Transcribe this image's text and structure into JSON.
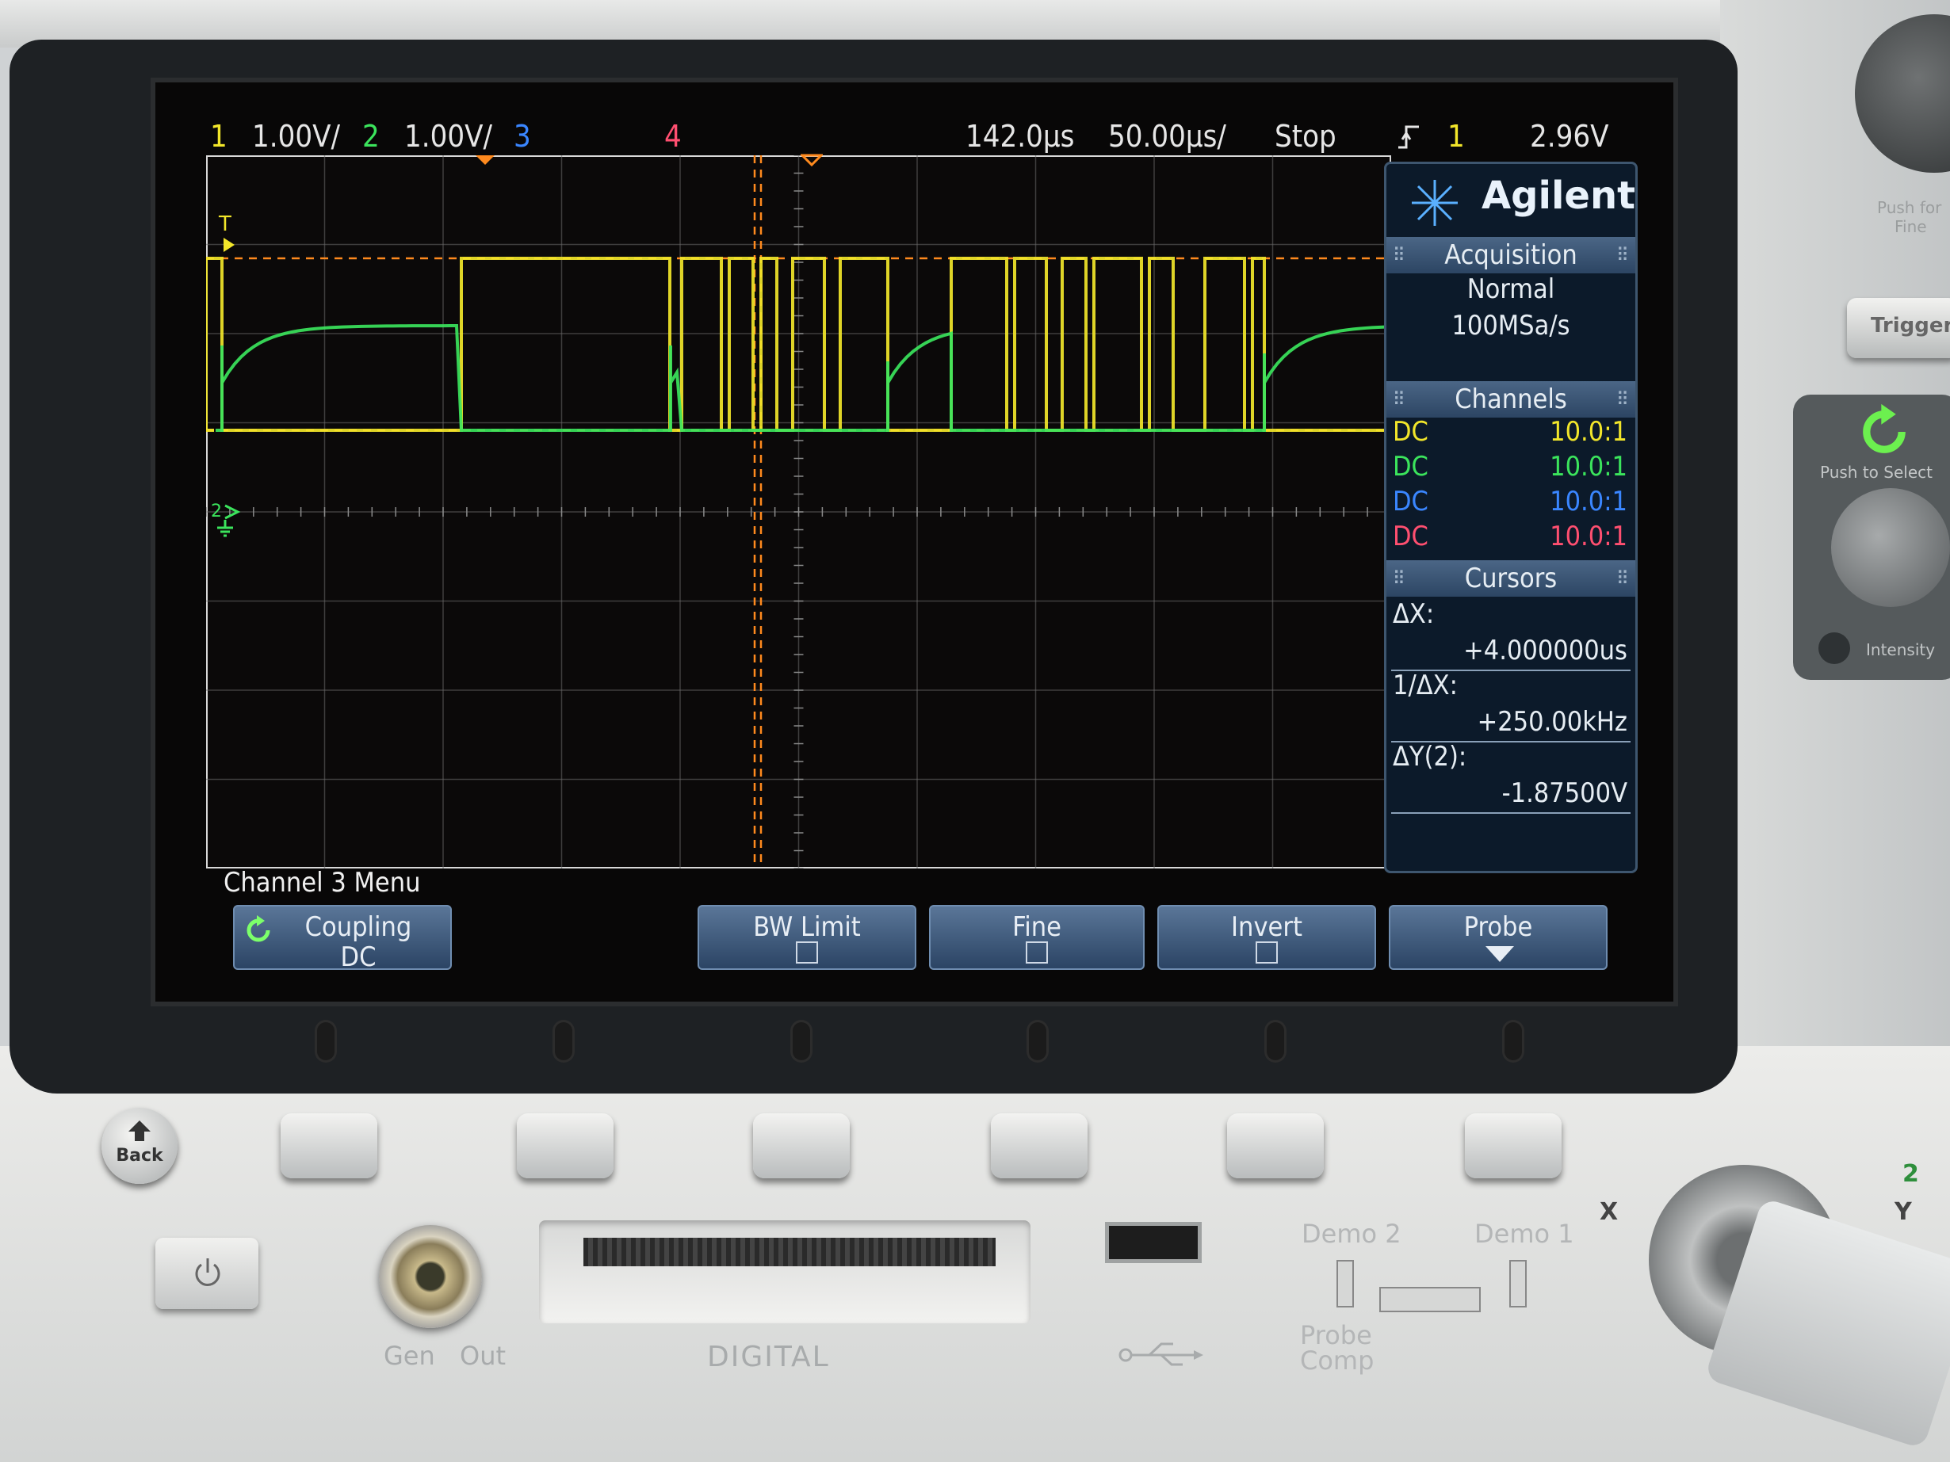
{
  "status_bar": {
    "ch1_num": "1",
    "ch1_scale": "1.00V/",
    "ch2_num": "2",
    "ch2_scale": "1.00V/",
    "ch3_num": "3",
    "ch4_num": "4",
    "time_delay": "142.0µs",
    "time_scale": "50.00µs/",
    "run_state": "Stop",
    "trigger_source": "1",
    "trigger_level": "2.96V"
  },
  "brand": {
    "name": "Agilent"
  },
  "acquisition": {
    "title": "Acquisition",
    "mode": "Normal",
    "rate": "100MSa/s"
  },
  "channels_panel": {
    "title": "Channels",
    "rows": [
      {
        "coupling": "DC",
        "probe": "10.0:1",
        "color": "#f2e62a"
      },
      {
        "coupling": "DC",
        "probe": "10.0:1",
        "color": "#3be45c"
      },
      {
        "coupling": "DC",
        "probe": "10.0:1",
        "color": "#3a86ff"
      },
      {
        "coupling": "DC",
        "probe": "10.0:1",
        "color": "#ff4f70"
      }
    ]
  },
  "cursors_panel": {
    "title": "Cursors",
    "dx_label": "ΔX:",
    "dx_value": "+4.000000us",
    "inv_dx_label": "1/ΔX:",
    "inv_dx_value": "+250.00kHz",
    "dy_label": "ΔY(2):",
    "dy_value": "-1.87500V"
  },
  "menu": {
    "title": "Channel 3 Menu",
    "softkeys": [
      {
        "label": "Coupling",
        "value": "DC"
      },
      {
        "label": "BW Limit",
        "checked": false
      },
      {
        "label": "Fine",
        "checked": false
      },
      {
        "label": "Invert",
        "checked": false
      },
      {
        "label": "Probe"
      }
    ]
  },
  "front_panel": {
    "back_label": "Back",
    "gen_label": "Gen",
    "out_label": "Out",
    "digital_label": "DIGITAL",
    "demo2_label": "Demo 2",
    "demo1_label": "Demo 1",
    "probe_label": "Probe",
    "comp_label": "Comp",
    "trigger_label": "Trigger",
    "push_fine_1": "Push for",
    "push_fine_2": "Fine",
    "push_select_label": "Push to Select",
    "intensity_label": "Intensity",
    "x_label": "X",
    "y_label": "Y",
    "input2_label": "2"
  },
  "colors": {
    "ch1": "#f2e62a",
    "ch2": "#3be45c",
    "ch3": "#3a86ff",
    "ch4": "#ff4f70",
    "cursor": "#ff8a1e",
    "screen_bg": "#0b0909",
    "panel_header": "#3a5577"
  },
  "icons": {
    "trigger_edge": "rising-edge-icon",
    "ground_marker": "ground-icon",
    "coupling_cycle": "cycle-arrow-icon",
    "probe_more": "down-arrow-icon",
    "back": "up-arrow-icon",
    "power": "power-icon",
    "usb": "usb-icon"
  }
}
